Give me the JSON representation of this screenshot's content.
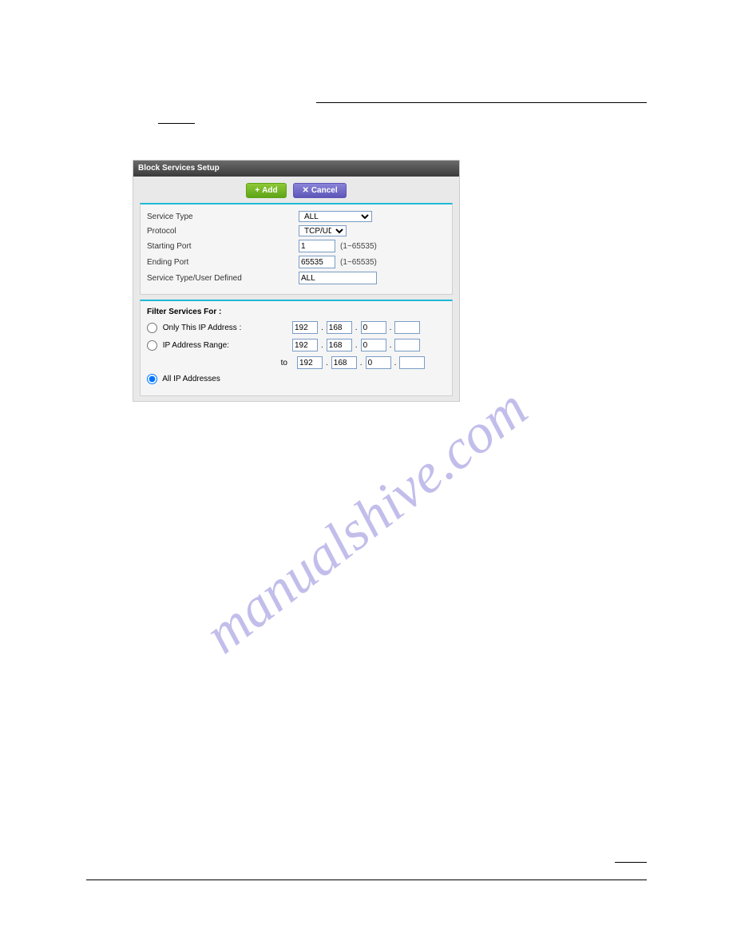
{
  "watermark": "manualshive.com",
  "panel": {
    "title": "Block Services Setup",
    "buttons": {
      "add": "Add",
      "cancel": "Cancel"
    },
    "form": {
      "service_type": {
        "label": "Service Type",
        "value": "ALL"
      },
      "protocol": {
        "label": "Protocol",
        "value": "TCP/UDP"
      },
      "starting_port": {
        "label": "Starting Port",
        "value": "1",
        "hint": "(1~65535)"
      },
      "ending_port": {
        "label": "Ending Port",
        "value": "65535",
        "hint": "(1~65535)"
      },
      "user_defined": {
        "label": "Service Type/User Defined",
        "value": "ALL"
      }
    },
    "filter": {
      "title": "Filter Services For :",
      "only_this": {
        "label": "Only This IP Address :",
        "ip": [
          "192",
          "168",
          "0",
          ""
        ]
      },
      "range": {
        "label": "IP Address Range:",
        "from": [
          "192",
          "168",
          "0",
          ""
        ],
        "to_label": "to",
        "to": [
          "192",
          "168",
          "0",
          ""
        ]
      },
      "all": {
        "label": "All IP Addresses"
      },
      "selected": "all"
    }
  }
}
